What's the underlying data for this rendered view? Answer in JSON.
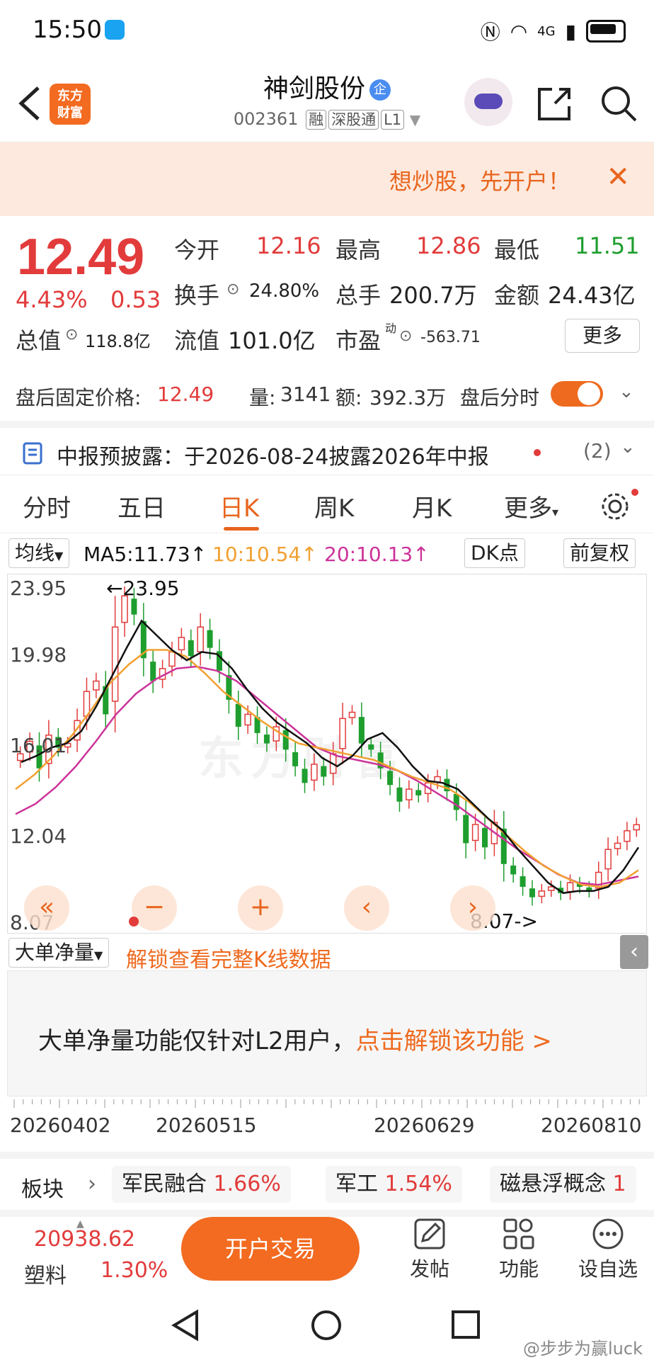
{
  "status_bar": {
    "time": "15:50",
    "network": "4G"
  },
  "header": {
    "logo_text_1": "东方",
    "logo_text_2": "财富",
    "stock_name": "神剑股份",
    "corp_badge": "企",
    "stock_code": "002361",
    "tags": [
      "融",
      "深股通",
      "L1"
    ]
  },
  "promo": {
    "text": "想炒股，先开户！"
  },
  "quote": {
    "price": "12.49",
    "change_pct": "4.43%",
    "change": "0.53",
    "open_label": "今开",
    "open": "12.16",
    "high_label": "最高",
    "high": "12.86",
    "low_label": "最低",
    "low": "11.51",
    "turnover_label": "换手",
    "turnover": "24.80%",
    "volume_label": "总手",
    "volume": "200.7万",
    "amount_label": "金额",
    "amount": "24.43亿",
    "mktcap_label": "总值",
    "mktcap": "118.8亿",
    "float_label": "流值",
    "float": "101.0亿",
    "pe_label": "市盈",
    "pe_sup": "动",
    "pe": "-563.71",
    "more_label": "更多"
  },
  "after_hours": {
    "price_label": "盘后固定价格:",
    "price": "12.49",
    "vol_label": "量:",
    "vol": "3141",
    "amt_label": "额:",
    "amt": "392.3万",
    "timeshare_label": "盘后分时"
  },
  "disclosure": {
    "text": "中报预披露：于2026-08-24披露2026年中报",
    "count": "(2)"
  },
  "tabs": [
    "分时",
    "五日",
    "日K",
    "周K",
    "月K",
    "更多"
  ],
  "active_tab": 2,
  "ma_row": {
    "selector": "均线",
    "ma5": "MA5:11.73↑",
    "ma10": "10:10.54↑",
    "ma20": "20:10.13↑",
    "dk_label": "DK点",
    "adjust_label": "前复权"
  },
  "chart_labels": {
    "y_ticks": [
      "23.95",
      "19.98",
      "16.01",
      "12.04",
      "8.07"
    ],
    "max_annotation": "←23.95",
    "min_annotation": "8.07->",
    "watermark": "东方财富"
  },
  "chart_data": {
    "type": "candlestick",
    "ylim": [
      8.07,
      23.95
    ],
    "y_ticks": [
      23.95,
      19.98,
      16.01,
      12.04,
      8.07
    ],
    "x_ticks": [
      "20260402",
      "20260515",
      "20260629",
      "20260810"
    ],
    "max_label": 23.95,
    "min_label": 8.07,
    "candles_close": [
      15.9,
      16.5,
      15.2,
      16.8,
      16.2,
      16.4,
      17.5,
      18.9,
      19.4,
      17.8,
      22.0,
      23.5,
      22.6,
      20.5,
      19.4,
      20.0,
      20.8,
      21.5,
      20.6,
      22.0,
      21.0,
      19.9,
      18.5,
      17.2,
      17.8,
      16.9,
      16.4,
      17.2,
      16.1,
      15.3,
      14.5,
      15.4,
      14.8,
      15.9,
      17.6,
      17.9,
      16.4,
      16.1,
      15.2,
      14.4,
      13.6,
      14.2,
      13.9,
      14.5,
      14.8,
      14.1,
      13.2,
      11.6,
      12.5,
      11.4,
      12.6,
      10.6,
      10.1,
      9.5,
      9.0,
      9.3,
      9.5,
      9.2,
      9.7,
      9.5,
      9.3,
      10.2,
      11.3,
      11.6,
      12.2,
      12.49
    ],
    "series": [
      {
        "name": "MA5",
        "values": [
          15.5,
          15.8,
          16.2,
          16.4,
          17.0,
          18.2,
          19.6,
          21.0,
          22.3,
          21.6,
          20.9,
          20.4,
          20.8,
          20.7,
          20.0,
          19.0,
          18.1,
          17.4,
          16.9,
          16.4,
          15.7,
          15.3,
          15.8,
          16.6,
          16.9,
          16.2,
          15.3,
          14.6,
          14.5,
          14.2,
          13.5,
          12.8,
          12.2,
          11.3,
          10.5,
          9.7,
          9.2,
          9.3,
          9.3,
          9.5,
          10.3,
          11.4
        ]
      },
      {
        "name": "MA10",
        "values": [
          14.2,
          14.9,
          15.8,
          16.8,
          18.0,
          19.3,
          20.2,
          20.9,
          20.9,
          20.6,
          19.8,
          18.9,
          18.2,
          17.5,
          16.9,
          16.4,
          16.2,
          16.0,
          15.8,
          15.6,
          15.2,
          14.8,
          14.5,
          14.2,
          13.6,
          12.8,
          12.0,
          11.2,
          10.5,
          10.0,
          9.6,
          9.5,
          9.7,
          10.3
        ]
      },
      {
        "name": "MA20",
        "values": [
          13.0,
          13.5,
          14.3,
          15.3,
          16.5,
          17.8,
          18.8,
          19.5,
          20.0,
          20.1,
          19.9,
          19.4,
          18.6,
          17.8,
          17.0,
          16.2,
          15.8,
          15.6,
          15.4,
          15.1,
          14.6,
          14.0,
          13.4,
          12.7,
          12.0,
          11.3,
          10.7,
          10.1,
          9.7,
          9.6,
          9.8,
          10.0
        ]
      }
    ]
  },
  "indicator": {
    "selector": "大单净量",
    "unlock_link": "解锁查看完整K线数据",
    "panel_text": "大单净量功能仅针对L2用户，",
    "panel_link": "点击解锁该功能 >"
  },
  "date_axis": [
    "20260402",
    "20260515",
    "20260629",
    "20260810"
  ],
  "sectors": {
    "label": "板块",
    "items": [
      {
        "name": "军民融合",
        "pct": "1.66%"
      },
      {
        "name": "军工",
        "pct": "1.54%"
      },
      {
        "name": "磁悬浮概念",
        "pct": "1"
      }
    ]
  },
  "toolbar": {
    "index_value": "20938.62",
    "index_name": "塑料",
    "index_pct": "1.30%",
    "trade_button": "开户交易",
    "post": "发帖",
    "function": "功能",
    "watchlist": "设自选"
  },
  "watermark_text": "@步步为赢luck",
  "colors": {
    "up": "#e23b3b",
    "down": "#1e9e2e",
    "accent": "#ee6a1f",
    "ma5": "#111111",
    "ma10": "#f0a030",
    "ma20": "#cc3399"
  }
}
